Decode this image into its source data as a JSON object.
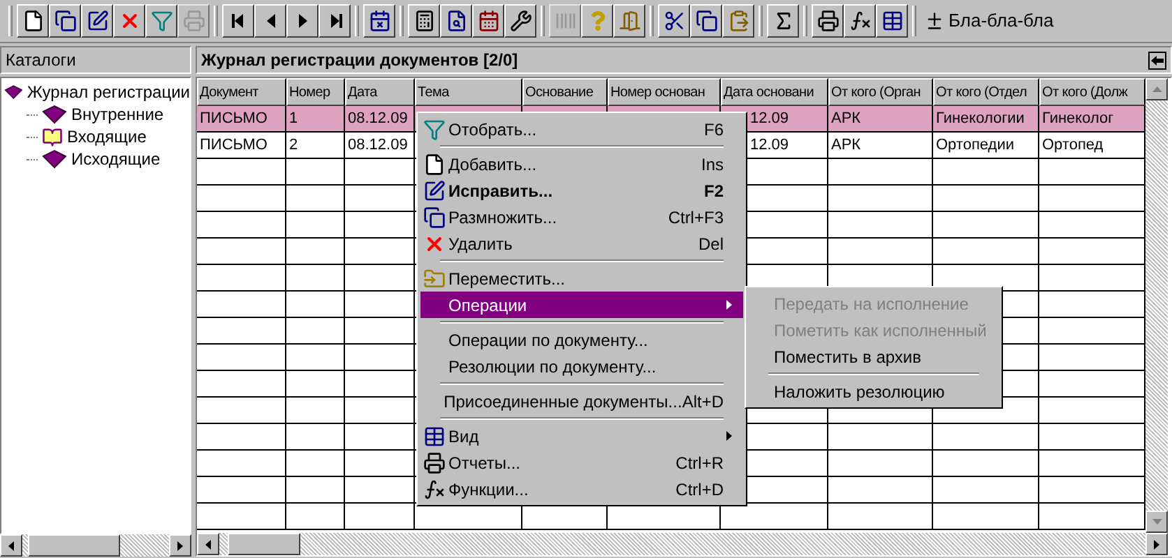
{
  "toolbar": {
    "groups": [
      [
        {
          "kind": "new",
          "disabled": false
        },
        {
          "kind": "copy",
          "disabled": false
        },
        {
          "kind": "edit",
          "disabled": false
        },
        {
          "kind": "delete",
          "disabled": false
        },
        {
          "kind": "filter",
          "disabled": false
        },
        {
          "kind": "print",
          "disabled": true
        }
      ],
      [
        {
          "kind": "first",
          "disabled": false
        },
        {
          "kind": "prev",
          "disabled": false
        },
        {
          "kind": "next",
          "disabled": false
        },
        {
          "kind": "last",
          "disabled": false
        }
      ],
      [
        {
          "kind": "alert",
          "disabled": false
        }
      ],
      [
        {
          "kind": "calc",
          "disabled": false
        },
        {
          "kind": "search",
          "disabled": false
        },
        {
          "kind": "calendar",
          "disabled": false
        },
        {
          "kind": "tools",
          "disabled": false
        }
      ],
      [
        {
          "kind": "barcode",
          "disabled": true
        },
        {
          "kind": "help",
          "disabled": false
        },
        {
          "kind": "exit",
          "disabled": false
        }
      ],
      [
        {
          "kind": "cut",
          "disabled": false
        },
        {
          "kind": "copy",
          "disabled": false
        },
        {
          "kind": "paste",
          "disabled": false
        }
      ],
      [
        {
          "kind": "sigma",
          "disabled": false
        }
      ],
      [
        {
          "kind": "print",
          "disabled": false
        },
        {
          "kind": "fx",
          "disabled": false
        },
        {
          "kind": "table",
          "disabled": false
        }
      ]
    ],
    "label": "Бла-бла-бла"
  },
  "catalogs": {
    "title": "Каталоги",
    "tree": [
      {
        "label": "Журнал регистрации",
        "children": [
          {
            "label": "Внутренние"
          },
          {
            "label": "Входящие"
          },
          {
            "label": "Исходящие"
          }
        ]
      }
    ]
  },
  "journal": {
    "title": "Журнал регистрации документов [2/0]",
    "columns": [
      "Документ",
      "Номер",
      "Дата",
      "Тема",
      "Основание",
      "Номер основан",
      "Дата основани",
      "От кого (Орган",
      "От кого (Отдел",
      "От кого (Долж"
    ],
    "rows": [
      {
        "selected": true,
        "document": "ПИСЬМО",
        "number": "1",
        "date": "08.12.09",
        "date_basis": "12.09",
        "org": "АРК",
        "dept": "Гинекологии",
        "position": "Гинеколог"
      },
      {
        "selected": false,
        "document": "ПИСЬМО",
        "number": "2",
        "date": "08.12.09",
        "date_basis": "12.09",
        "org": "АРК",
        "dept": "Ортопедии",
        "position": "Ортопед"
      }
    ]
  },
  "context_menu": [
    {
      "kind": "item",
      "label": "Отобрать...",
      "shortcut": "F6",
      "bold": false,
      "selected": false,
      "submenu": false
    },
    {
      "kind": "separator"
    },
    {
      "kind": "item",
      "label": "Добавить...",
      "shortcut": "Ins",
      "bold": false,
      "selected": false,
      "submenu": false
    },
    {
      "kind": "item",
      "label": "Исправить...",
      "shortcut": "F2",
      "bold": true,
      "selected": false,
      "submenu": false
    },
    {
      "kind": "item",
      "label": "Размножить...",
      "shortcut": "Ctrl+F3",
      "bold": false,
      "selected": false,
      "submenu": false
    },
    {
      "kind": "item",
      "label": "Удалить",
      "shortcut": "Del",
      "bold": false,
      "selected": false,
      "submenu": false
    },
    {
      "kind": "separator"
    },
    {
      "kind": "item",
      "label": "Переместить...",
      "bold": false,
      "selected": false,
      "submenu": false
    },
    {
      "kind": "item",
      "label": "Операции",
      "bold": false,
      "selected": true,
      "submenu": true
    },
    {
      "kind": "separator"
    },
    {
      "kind": "item",
      "label": "Операции по документу...",
      "bold": false,
      "selected": false,
      "submenu": false
    },
    {
      "kind": "item",
      "label": "Резолюции по документу...",
      "bold": false,
      "selected": false,
      "submenu": false
    },
    {
      "kind": "separator"
    },
    {
      "kind": "item",
      "label": "Присоединенные документы...",
      "shortcut": "Alt+D",
      "bold": false,
      "selected": false,
      "submenu": false
    },
    {
      "kind": "separator"
    },
    {
      "kind": "item",
      "label": "Вид",
      "bold": false,
      "selected": false,
      "submenu": true
    },
    {
      "kind": "item",
      "label": "Отчеты...",
      "shortcut": "Ctrl+R",
      "bold": false,
      "selected": false,
      "submenu": false
    },
    {
      "kind": "item",
      "label": "Функции...",
      "shortcut": "Ctrl+D",
      "bold": false,
      "selected": false,
      "submenu": false
    }
  ],
  "submenu": [
    {
      "kind": "item",
      "label": "Передать на исполнение",
      "disabled": true
    },
    {
      "kind": "item",
      "label": "Пометить как исполненный",
      "disabled": true
    },
    {
      "kind": "item",
      "label": "Поместить в архив",
      "disabled": false
    },
    {
      "kind": "separator"
    },
    {
      "kind": "item",
      "label": "Наложить резолюцию",
      "disabled": false
    }
  ]
}
